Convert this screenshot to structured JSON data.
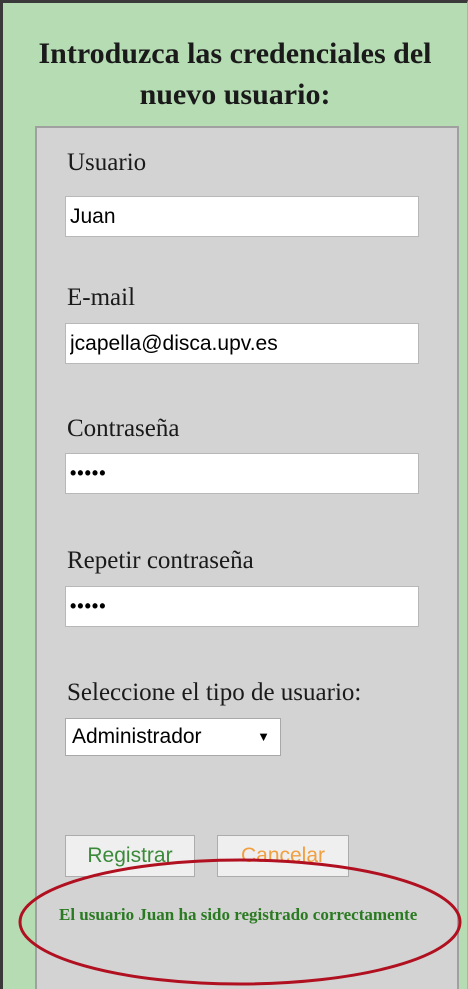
{
  "page": {
    "title": "Introduzca las credenciales del nuevo usuario:"
  },
  "form": {
    "username": {
      "label": "Usuario",
      "value": "Juan"
    },
    "email": {
      "label": "E-mail",
      "value": "jcapella@disca.upv.es"
    },
    "password": {
      "label": "Contraseña",
      "value": "•••••"
    },
    "password_repeat": {
      "label": "Repetir contraseña",
      "value": "•••••"
    },
    "user_type": {
      "label": "Seleccione el tipo de usuario:",
      "selected": "Administrador"
    },
    "buttons": {
      "register": "Registrar",
      "cancel": "Cancelar"
    },
    "status_message": "El usuario Juan ha sido registrado correctamente"
  },
  "colors": {
    "outer_background": "#b6dcb3",
    "panel_background": "#d3d3d3",
    "success_text": "#2a7a22",
    "register_text": "#3a8a3a",
    "cancel_text": "#f0a040",
    "highlight_ellipse": "#b01020"
  },
  "icons": {
    "select_arrow": "dropdown-arrow-icon"
  }
}
